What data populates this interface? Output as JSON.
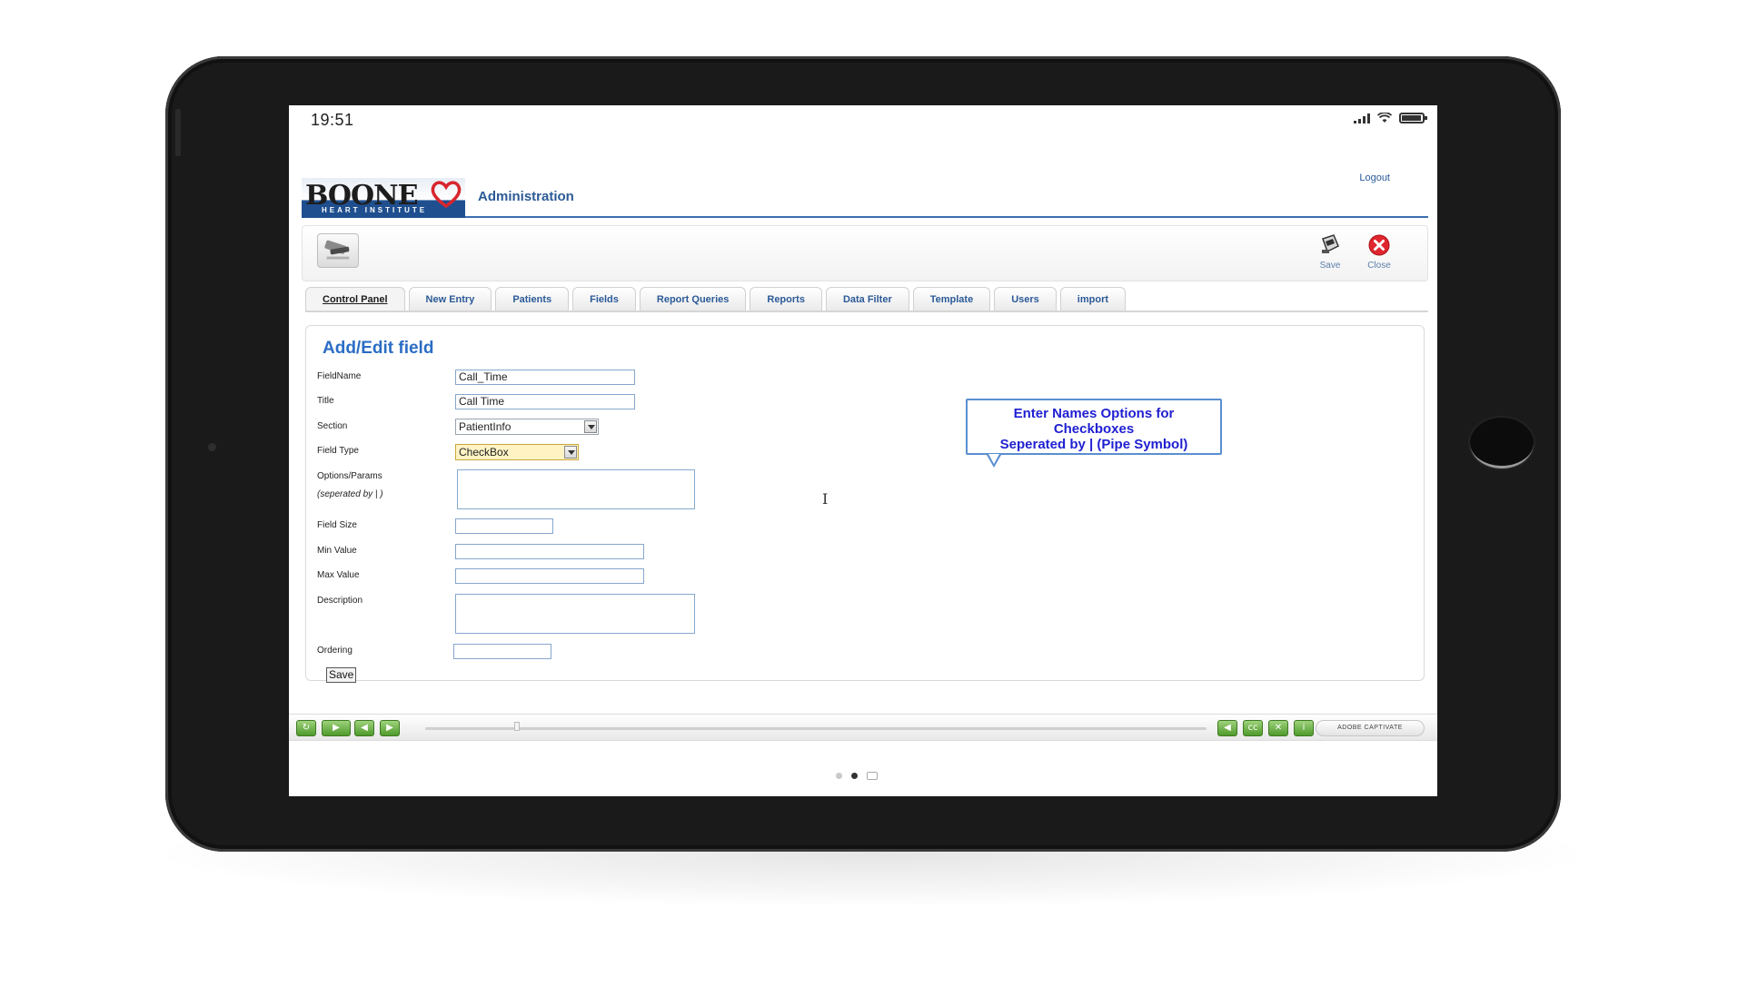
{
  "status_bar": {
    "time": "19:51"
  },
  "header": {
    "logo_word": "BOONE",
    "logo_sub": "HEART INSTITUTE",
    "title": "Administration",
    "logout": "Logout"
  },
  "toolbar": {
    "save_label": "Save",
    "close_label": "Close"
  },
  "tabs": [
    "Control Panel",
    "New Entry",
    "Patients",
    "Fields",
    "Report Queries",
    "Reports",
    "Data Filter",
    "Template",
    "Users",
    "import"
  ],
  "form": {
    "title": "Add/Edit field",
    "fieldname_label": "FieldName",
    "fieldname_value": "Call_Time",
    "title_label": "Title",
    "title_value": "Call Time",
    "section_label": "Section",
    "section_value": "PatientInfo",
    "fieldtype_label": "Field Type",
    "fieldtype_value": "CheckBox",
    "options_label": "Options/Params",
    "options_sub": "(seperated by | )",
    "fieldsize_label": "Field Size",
    "minvalue_label": "Min Value",
    "maxvalue_label": "Max Value",
    "description_label": "Description",
    "ordering_label": "Ordering",
    "save_button": "Save"
  },
  "callout": {
    "line1": "Enter Names Options for",
    "line2": "Checkboxes",
    "line3": "Seperated by | (Pipe Symbol)"
  },
  "playbar": {
    "brand": "ADOBE CAPTIVATE"
  },
  "colors": {
    "brand_blue": "#2b5a97",
    "title_blue": "#2b6dc4",
    "callout_text": "#1f1fd2",
    "field_type_bg": "#fff3c4",
    "play_green": "#4f9a2c",
    "close_red": "#e0262e"
  }
}
